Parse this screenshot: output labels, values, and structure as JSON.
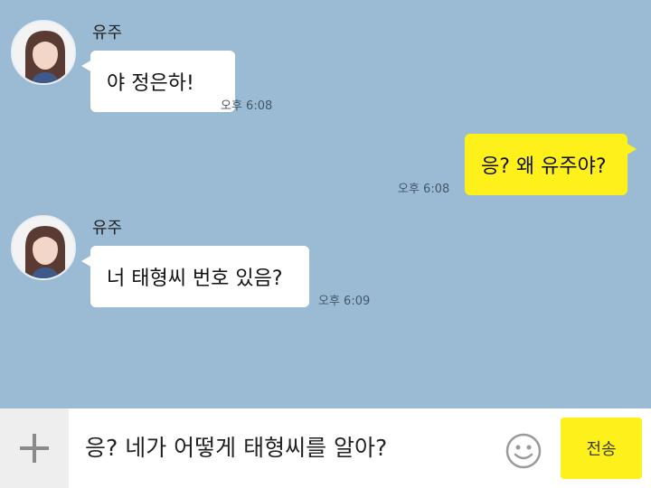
{
  "messages": [
    {
      "sender": "유주",
      "text": "야 정은하!",
      "time": "오후 6:08",
      "direction": "incoming"
    },
    {
      "sender": "",
      "text": "응? 왜 유주야?",
      "time": "오후 6:08",
      "direction": "outgoing"
    },
    {
      "sender": "유주",
      "text": "너 태형씨 번호 있음?",
      "time": "오후 6:09",
      "direction": "incoming"
    }
  ],
  "input": {
    "value": "응? 네가 어떻게 태형씨를 알아?"
  },
  "send_button": {
    "label": "전송"
  },
  "icons": {
    "attach": "plus-icon",
    "emoji": "emoji-icon",
    "avatar": "profile-avatar"
  },
  "colors": {
    "background": "#9bbbd4",
    "outgoing_bubble": "#fef01b",
    "incoming_bubble": "#ffffff",
    "send_button": "#fef01b"
  }
}
